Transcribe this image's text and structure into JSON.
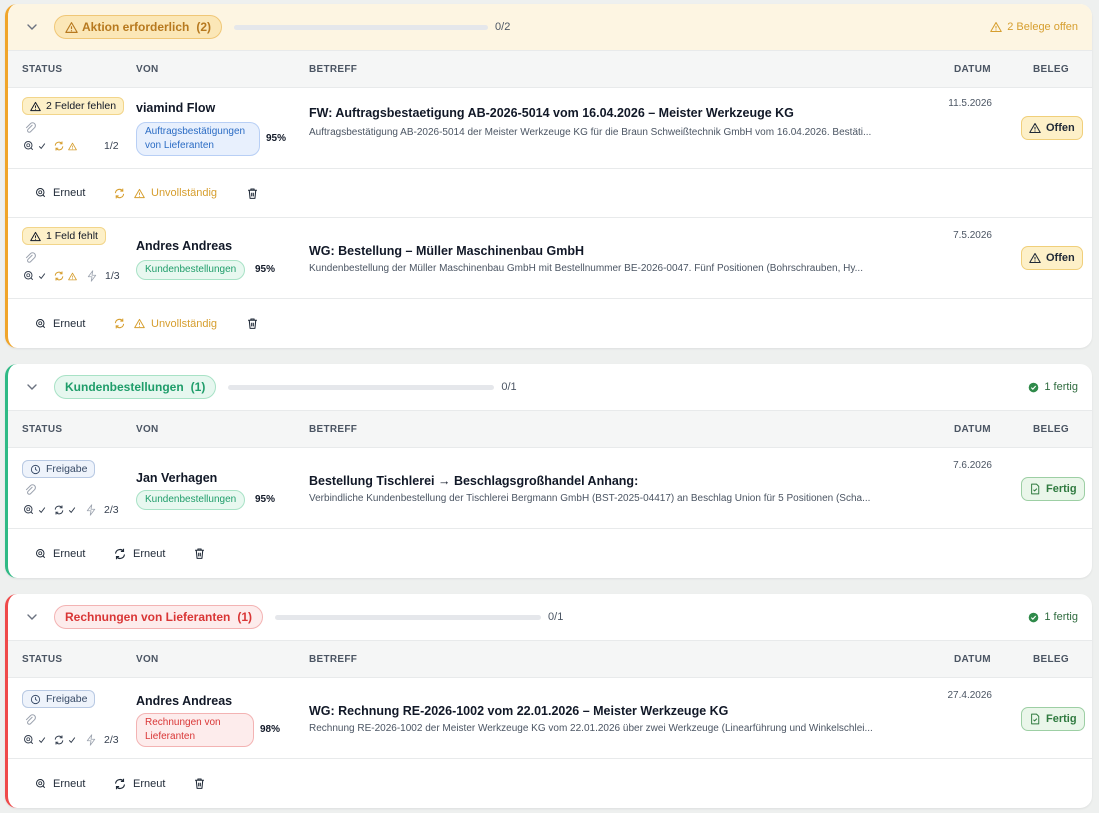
{
  "columns": {
    "status": "STATUS",
    "von": "VON",
    "betreff": "BETREFF",
    "datum": "DATUM",
    "beleg": "BELEG"
  },
  "groups": [
    {
      "title": "Aktion erforderlich",
      "count": "(2)",
      "progress": "0/2",
      "progress_value": 0,
      "status": "2 Belege offen",
      "accent": "#f0a52a",
      "rows": [
        {
          "badge": "2 Felder fehlen",
          "counter": "1/2",
          "von": "viamind Flow",
          "tag": "Auftragsbestätigungen von Lieferanten",
          "confidence": "95%",
          "subject": "FW: Auftragsbestaetigung AB-2026-5014 vom 16.04.2026 – Meister Werkzeuge KG",
          "preview": "Auftragsbestätigung AB-2026-5014 der Meister Werkzeuge KG für die Braun Schweißtechnik GmbH vom 16.04.2026. Bestäti...",
          "date": "11.5.2026",
          "beleg": "Offen",
          "retry": "Erneut",
          "state": "Unvollständig"
        },
        {
          "badge": "1 Feld fehlt",
          "counter": "1/3",
          "von": "Andres Andreas",
          "tag": "Kundenbestellungen",
          "confidence": "95%",
          "subject": "WG: Bestellung – Müller Maschinenbau GmbH",
          "preview": "Kundenbestellung der Müller Maschinenbau GmbH mit Bestellnummer BE-2026-0047. Fünf Positionen (Bohrschrauben, Hy...",
          "date": "7.5.2026",
          "beleg": "Offen",
          "retry": "Erneut",
          "state": "Unvollständig"
        }
      ]
    },
    {
      "title": "Kundenbestellungen",
      "count": "(1)",
      "progress": "0/1",
      "progress_value": 0,
      "status": "1 fertig",
      "accent": "#2fba85",
      "rows": [
        {
          "badge": "Freigabe",
          "counter": "2/3",
          "von": "Jan Verhagen",
          "tag": "Kundenbestellungen",
          "confidence": "95%",
          "subject": "Bestellung Tischlerei → Beschlagsgroßhandel Anhang:",
          "preview": "Verbindliche Kundenbestellung der Tischlerei Bergmann GmbH (BST-2025-04417) an Beschlag Union für 5 Positionen (Scha...",
          "date": "7.6.2026",
          "beleg": "Fertig",
          "retry": "Erneut",
          "retry2": "Erneut"
        }
      ]
    },
    {
      "title": "Rechnungen von Lieferanten",
      "count": "(1)",
      "progress": "0/1",
      "progress_value": 0,
      "status": "1 fertig",
      "accent": "#ef4a4a",
      "rows": [
        {
          "badge": "Freigabe",
          "counter": "2/3",
          "von": "Andres Andreas",
          "tag": "Rechnungen von Lieferanten",
          "confidence": "98%",
          "subject": "WG: Rechnung RE-2026-1002 vom 22.01.2026 – Meister Werkzeuge KG",
          "preview": "Rechnung RE-2026-1002 der Meister Werkzeuge KG vom 22.01.2026 über zwei Werkzeuge (Linearführung und Winkelschlei...",
          "date": "27.4.2026",
          "beleg": "Fertig",
          "retry": "Erneut",
          "retry2": "Erneut"
        }
      ]
    }
  ]
}
